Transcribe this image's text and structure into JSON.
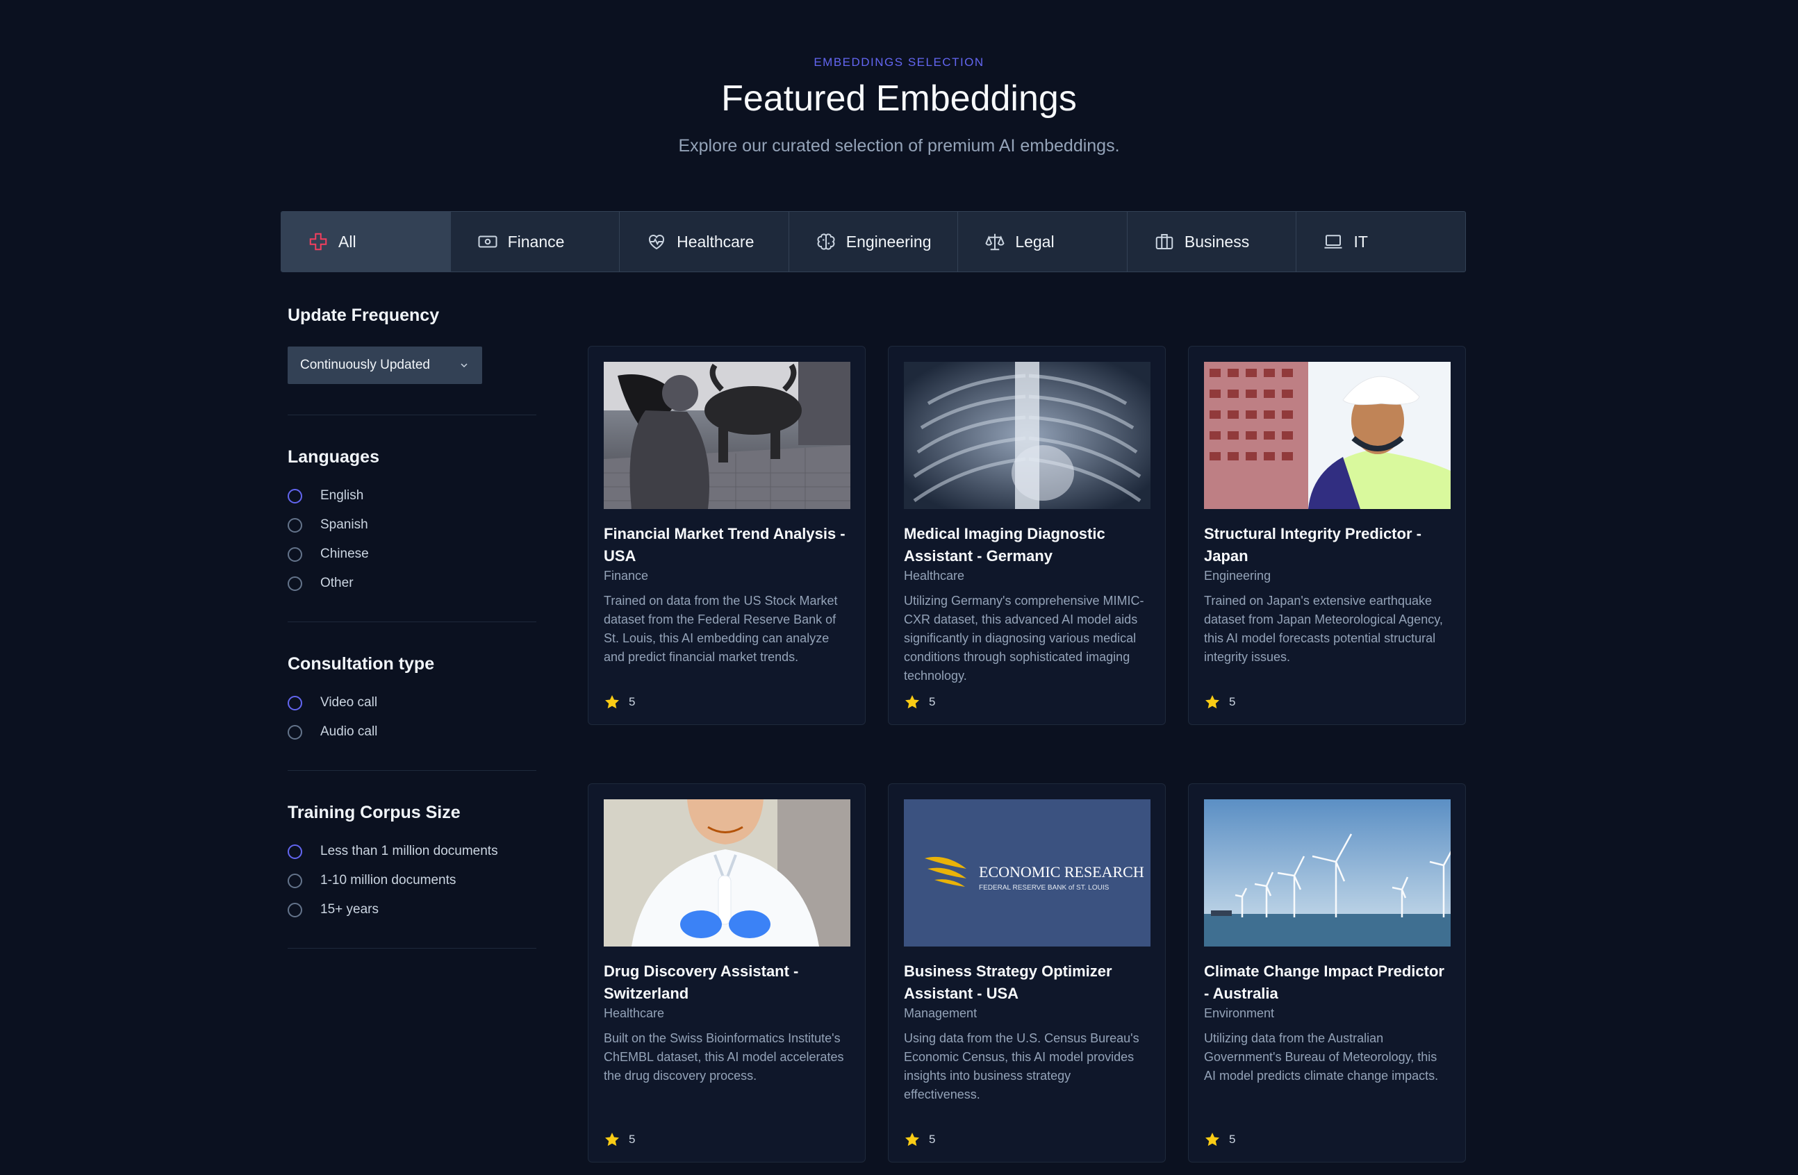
{
  "header": {
    "eyebrow": "EMBEDDINGS SELECTION",
    "title": "Featured Embeddings",
    "subtitle": "Explore our curated selection of premium AI embeddings."
  },
  "tabs": [
    {
      "label": "All",
      "icon": "medical-cross-icon",
      "active": true
    },
    {
      "label": "Finance",
      "icon": "banknote-icon"
    },
    {
      "label": "Healthcare",
      "icon": "heart-pulse-icon"
    },
    {
      "label": "Engineering",
      "icon": "brain-icon"
    },
    {
      "label": "Legal",
      "icon": "scale-icon"
    },
    {
      "label": "Business",
      "icon": "briefcase-icon"
    },
    {
      "label": "IT",
      "icon": "laptop-icon"
    }
  ],
  "filters": {
    "update_frequency": {
      "title": "Update Frequency",
      "selected": "Continuously Updated"
    },
    "languages": {
      "title": "Languages",
      "options": [
        "English",
        "Spanish",
        "Chinese",
        "Other"
      ]
    },
    "consultation": {
      "title": "Consultation type",
      "options": [
        "Video call",
        "Audio call"
      ]
    },
    "corpus": {
      "title": "Training Corpus Size",
      "options": [
        "Less than 1 million documents",
        "1-10 million documents",
        "15+ years"
      ]
    }
  },
  "cards": [
    {
      "title": "Financial Market Trend Analysis - USA",
      "category": "Finance",
      "description": "Trained on data from the US Stock Market dataset from the Federal Reserve Bank of St. Louis, this AI embedding can analyze and predict financial market trends.",
      "rating": "5"
    },
    {
      "title": "Medical Imaging Diagnostic Assistant - Germany",
      "category": "Healthcare",
      "description": "Utilizing Germany's comprehensive MIMIC-CXR dataset, this advanced AI model aids significantly in diagnosing various medical conditions through sophisticated imaging technology.",
      "rating": "5"
    },
    {
      "title": "Structural Integrity Predictor - Japan",
      "category": "Engineering",
      "description": "Trained on Japan's extensive earthquake dataset from Japan Meteorological Agency, this AI model forecasts potential structural integrity issues.",
      "rating": "5"
    },
    {
      "title": "Drug Discovery Assistant - Switzerland",
      "category": "Healthcare",
      "description": "Built on the Swiss Bioinformatics Institute's ChEMBL dataset, this AI model accelerates the drug discovery process.",
      "rating": "5"
    },
    {
      "title": "Business Strategy Optimizer Assistant - USA",
      "category": "Management",
      "description": "Using data from the U.S. Census Bureau's Economic Census, this AI model provides insights into business strategy effectiveness.",
      "rating": "5"
    },
    {
      "title": "Climate Change Impact Predictor - Australia",
      "category": "Environment",
      "description": "Utilizing data from the Australian Government's Bureau of Meteorology, this AI model predicts climate change impacts.",
      "rating": "5"
    }
  ],
  "logo": {
    "line1": "ECONOMIC RESEARCH",
    "line2": "FEDERAL RESERVE BANK of ST. LOUIS"
  }
}
